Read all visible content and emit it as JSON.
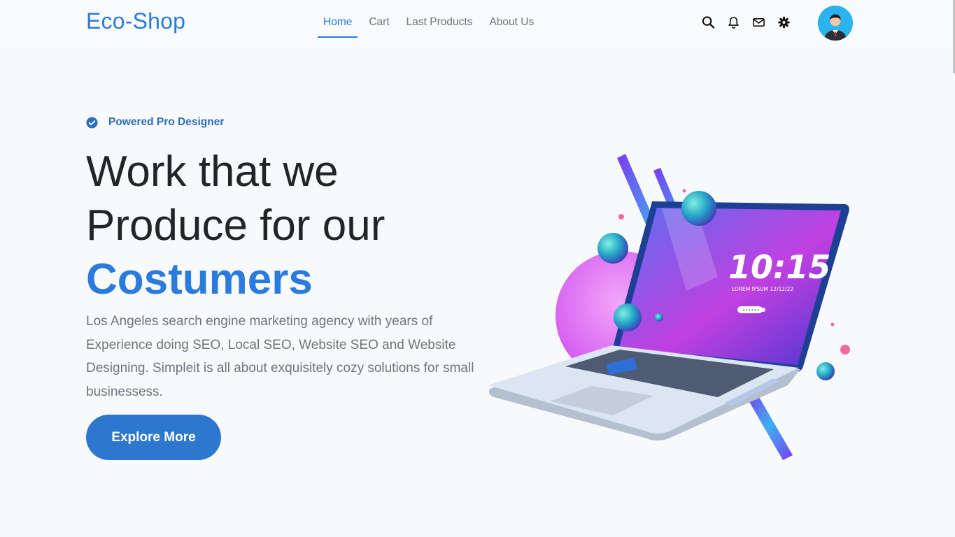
{
  "brand": "Eco-Shop",
  "nav": {
    "items": [
      {
        "label": "Home"
      },
      {
        "label": "Cart"
      },
      {
        "label": "Last Products"
      },
      {
        "label": "About Us"
      }
    ],
    "active": "Home"
  },
  "header_icons": [
    "search-icon",
    "bell-icon",
    "envelope-icon",
    "gear-icon"
  ],
  "colors": {
    "accent": "#2a7bdd",
    "button": "#2d77cf",
    "background": "#f8f9fb"
  },
  "hero": {
    "badge": "Powered Pro Designer",
    "headline_line1": "Work that we",
    "headline_line2": "Produce for our",
    "headline_accent": "Costumers",
    "description": "Los Angeles search engine marketing agency with years of Experience doing SEO, Local SEO, Website SEO and Website Designing. Simpleit is all about exquisitely cozy solutions for small businessess.",
    "cta": "Explore More",
    "illustration": {
      "time": "10:15",
      "caption": "LOREM IPSUM  12/12/22",
      "password": "••••••"
    }
  }
}
